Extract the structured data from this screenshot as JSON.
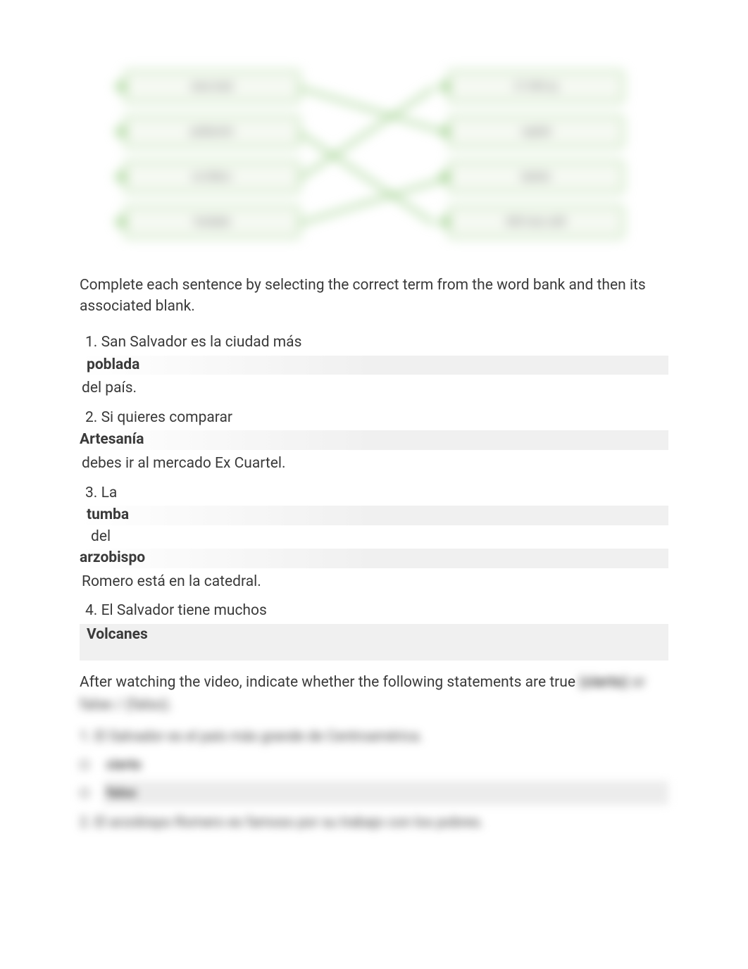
{
  "matching": {
    "left": [
      "área total",
      "población",
      "es ilídico",
      "fundada"
    ],
    "right": [
      "21 040 sq",
      "capital",
      "balnés",
      "600 mas café"
    ]
  },
  "instructions": "Complete each sentence by selecting the correct term from the word bank and then its associated blank.",
  "sentences": {
    "s1": {
      "num": "1.",
      "pre": "San Salvador es la ciudad más",
      "answer": "poblada",
      "post": "del país."
    },
    "s2": {
      "num": "2.",
      "pre": "Si quieres comparar",
      "answer": "Artesanía",
      "post": "debes ir al mercado Ex Cuartel."
    },
    "s3": {
      "num": "3.",
      "pre": "La",
      "answer1": "tumba",
      "mid": "del",
      "answer2": "arzobispo",
      "post": "Romero está en la catedral."
    },
    "s4": {
      "num": "4.",
      "pre": "El Salvador tiene muchos",
      "answer": "Volcanes"
    }
  },
  "section2": {
    "lead": "After watching the video, indicate whether the following statements are true",
    "lead_blur": "(cierto)",
    "lead_blur2": "or false / (falso).",
    "q1": "1. El Salvador es el país más grande de Centroamérica.",
    "opt_cierto": "cierto",
    "opt_falso": "falso",
    "q2": "2. El arzobispo Romero es famoso por su trabajo con los pobres."
  }
}
